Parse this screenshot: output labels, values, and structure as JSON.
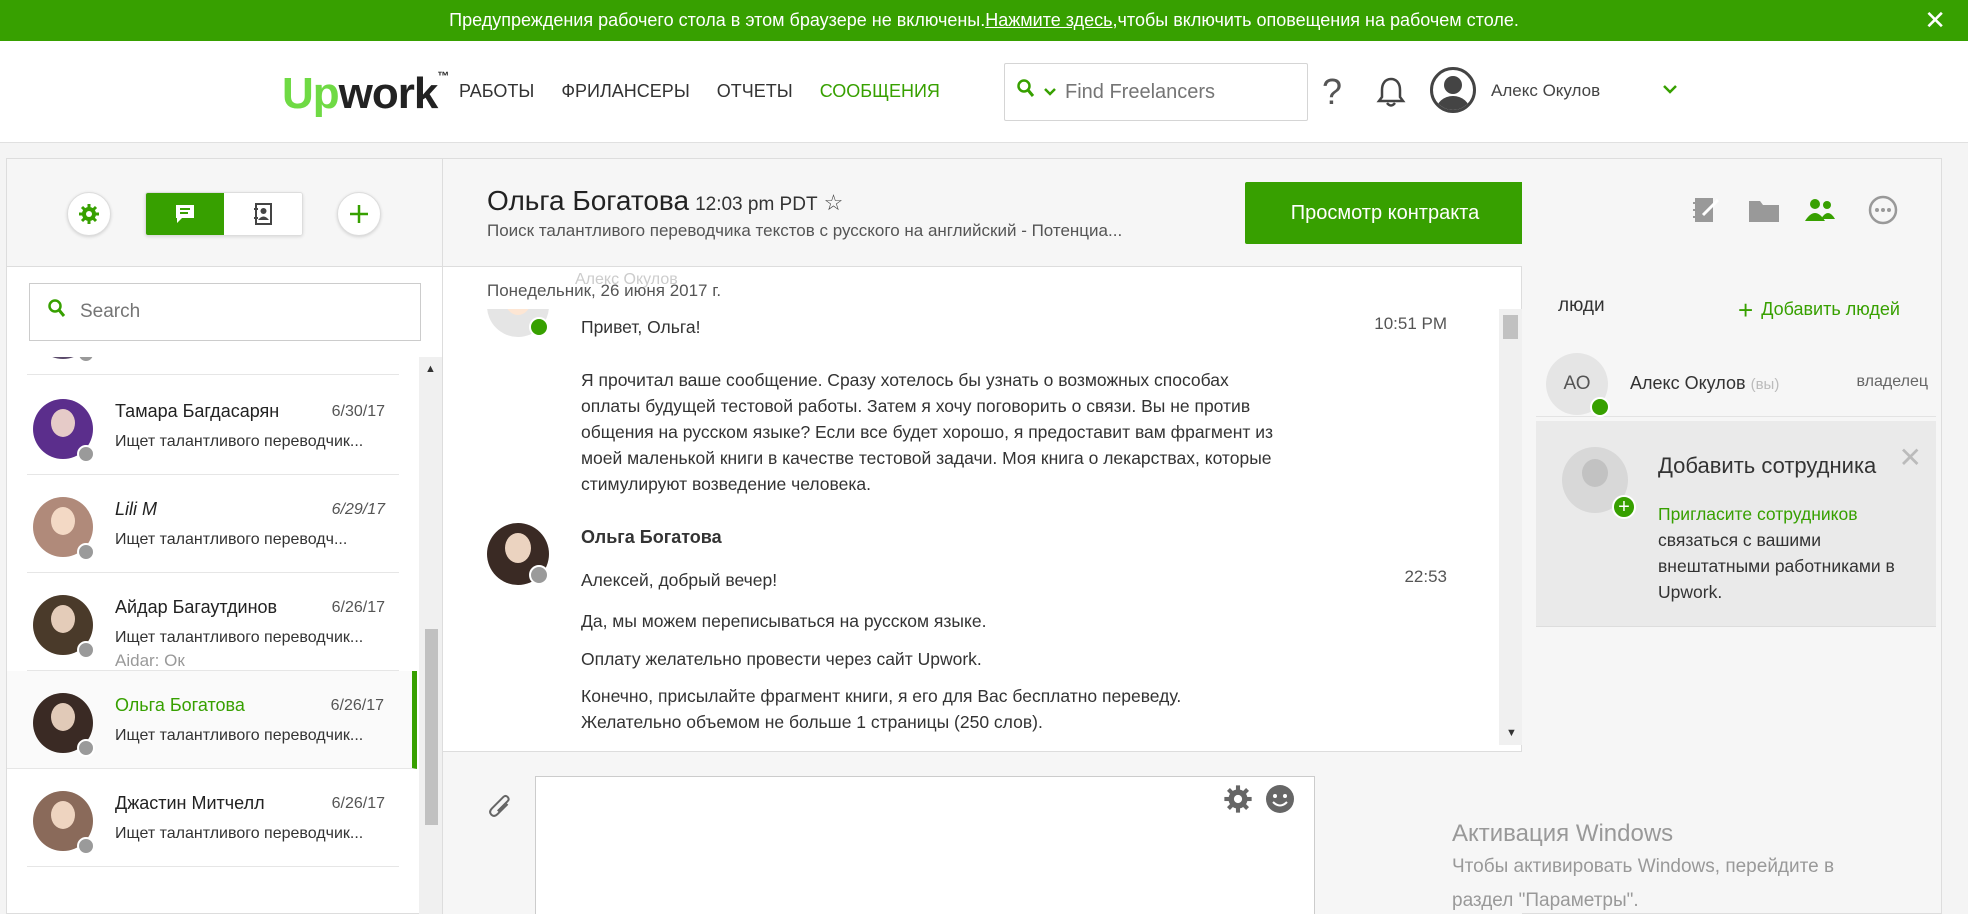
{
  "banner": {
    "text_before": "Предупреждения рабочего стола в этом браузере не включены. ",
    "link": "Нажмите здесь,",
    "text_after": " чтобы включить оповещения на рабочем столе.",
    "close": "✕"
  },
  "header": {
    "logo_up": "Up",
    "logo_work": "work",
    "logo_tm": "™",
    "nav": [
      "РАБОТЫ",
      "ФРИЛАНСЕРЫ",
      "ОТЧЕТЫ",
      "СООБЩЕНИЯ"
    ],
    "search_placeholder": "Find Freelancers",
    "help": "?",
    "user_name": "Алекс Окулов"
  },
  "sidebar": {
    "search_placeholder": "Search",
    "conversations": [
      {
        "name": "Тамара Багдасарян",
        "date": "6/30/17",
        "preview": "Ищет талантливого переводчик..."
      },
      {
        "name": "Lili M",
        "date": "6/29/17",
        "preview": "Ищет талантливого переводч..."
      },
      {
        "name": "Айдар Багаутдинов",
        "date": "6/26/17",
        "preview": "Ищет талантливого переводчик...",
        "preview2": "Aidar: Ок"
      },
      {
        "name": "Ольга Богатова",
        "date": "6/26/17",
        "preview": "Ищет талантливого переводчик..."
      },
      {
        "name": "Джастин Митчелл",
        "date": "6/26/17",
        "preview": "Ищет талантливого переводчик..."
      }
    ]
  },
  "chat": {
    "name": "Ольга Богатова",
    "time": "12:03 pm PDT",
    "subtitle": "Поиск талантливого переводчика текстов с русского на английский - Потенциа...",
    "contract_button": "Просмотр контракта",
    "ghost_sender": "Алекс Окулов",
    "date_separator": "Понедельник, 26 июня 2017 г.",
    "messages": {
      "first_greeting": "Привет, Ольга!",
      "first_time": "10:51 PM",
      "first_body": [
        "Я прочитал ваше сообщение. Сразу хотелось бы узнать о возможных способах",
        "оплаты будущей тестовой работы. Затем я хочу поговорить о связи. Вы не против",
        "общения на русском языке? Если все будет хорошо, я предоставит вам фрагмент из",
        "моей маленькой книги в качестве тестовой задачи. Моя книга о лекарствах, которые",
        "стимулируют возведение человека."
      ],
      "second_sender": "Ольга Богатова",
      "second_time": "22:53",
      "second_lines": [
        "Алексей, добрый вечер!",
        "Да, мы можем переписываться на русском языке.",
        "Оплату желательно провести через сайт Upwork.",
        "Конечно, присылайте фрагмент книги, я его для Вас бесплатно переведу.",
        "Желательно объемом не больше 1 страницы (250 слов)."
      ]
    }
  },
  "people": {
    "title": "люди",
    "add": "Добавить людей",
    "member_initials": "АО",
    "member_name": "Алекс Окулов",
    "member_you": "(вы)",
    "member_role": "владелец",
    "invite_title": "Добавить сотрудника",
    "invite_link": "Пригласите сотрудников",
    "invite_text": " связаться с вашими внештатными работниками в Upwork."
  },
  "watermark": {
    "title": "Активация Windows",
    "line1": "Чтобы активировать Windows, перейдите в",
    "line2": "раздел \"Параметры\"."
  },
  "colors": {
    "accent": "#37a000",
    "logo_green": "#6fda44"
  }
}
